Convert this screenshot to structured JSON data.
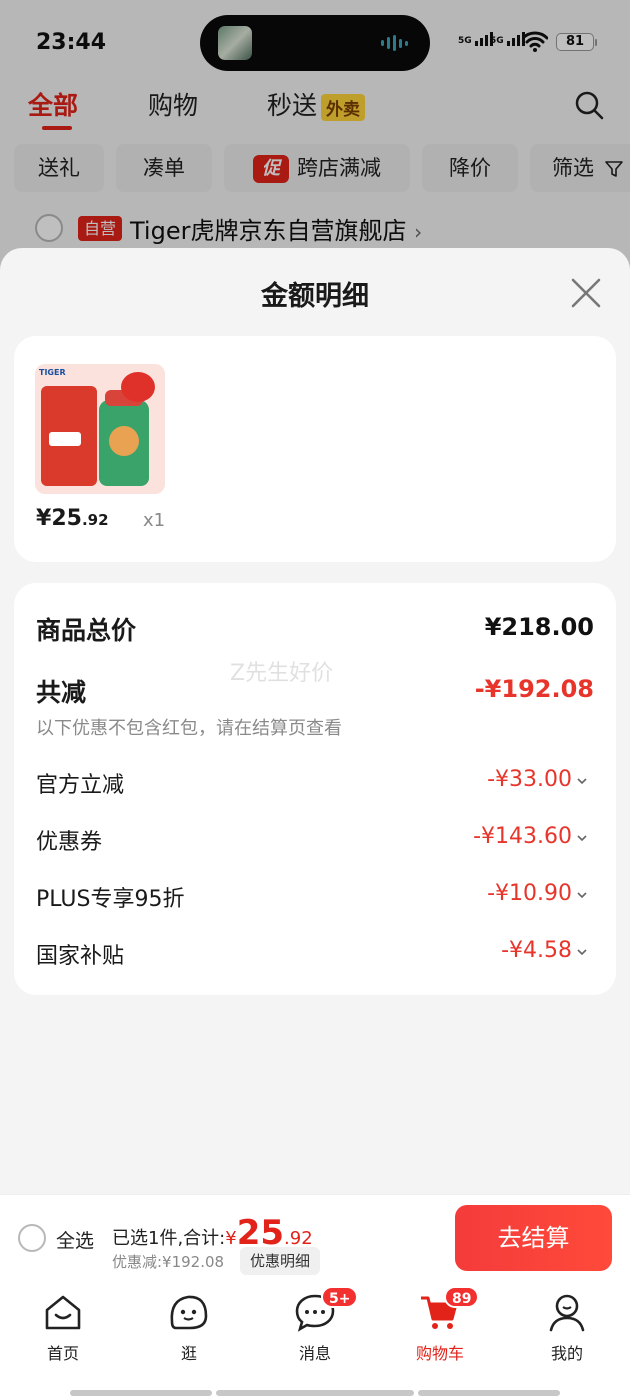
{
  "status_bar": {
    "time": "23:44",
    "signal1": "5G",
    "signal2": "5G",
    "battery": "81"
  },
  "top_tabs": {
    "all": "全部",
    "shopping": "购物",
    "fast": "秒送",
    "takeout_badge": "外卖"
  },
  "filter_chips": {
    "gift": "送礼",
    "bundle": "凑单",
    "promo_tag": "促",
    "cross_store": "跨店满减",
    "price_drop": "降价",
    "filter": "筛选"
  },
  "store": {
    "self_tag": "自营",
    "name": "Tiger虎牌京东自营旗舰店",
    "chevron": "›"
  },
  "sheet": {
    "title": "金额明细",
    "product": {
      "thumb_logo": "TIGER",
      "price_yen": "¥",
      "price_int": "25",
      "price_dec": ".92",
      "qty": "x1"
    },
    "watermark": "Z先生好价",
    "total_label": "商品总价",
    "total_value": "¥218.00",
    "discount_label": "共减",
    "discount_value": "-¥192.08",
    "note": "以下优惠不包含红包，请在结算页查看",
    "items": [
      {
        "label": "官方立减",
        "value": "-¥33.00"
      },
      {
        "label": "优惠券",
        "value": "-¥143.60"
      },
      {
        "label": "PLUS专享95折",
        "value": "-¥10.90"
      },
      {
        "label": "国家补贴",
        "value": "-¥4.58"
      }
    ]
  },
  "action_bar": {
    "select_all": "全选",
    "summary_prefix": "已选1件,合计:",
    "summary_yen": "¥",
    "summary_int": "25",
    "summary_dec": ".92",
    "saved": "优惠减:¥192.08",
    "detail_link": "优惠明细",
    "checkout": "去结算"
  },
  "tabbar": {
    "home": "首页",
    "browse": "逛",
    "messages": "消息",
    "messages_badge": "5+",
    "cart": "购物车",
    "cart_badge": "89",
    "me": "我的"
  },
  "colors": {
    "accent": "#e2231a",
    "discount_red": "#e8352b",
    "background": "#f4f4f4"
  }
}
